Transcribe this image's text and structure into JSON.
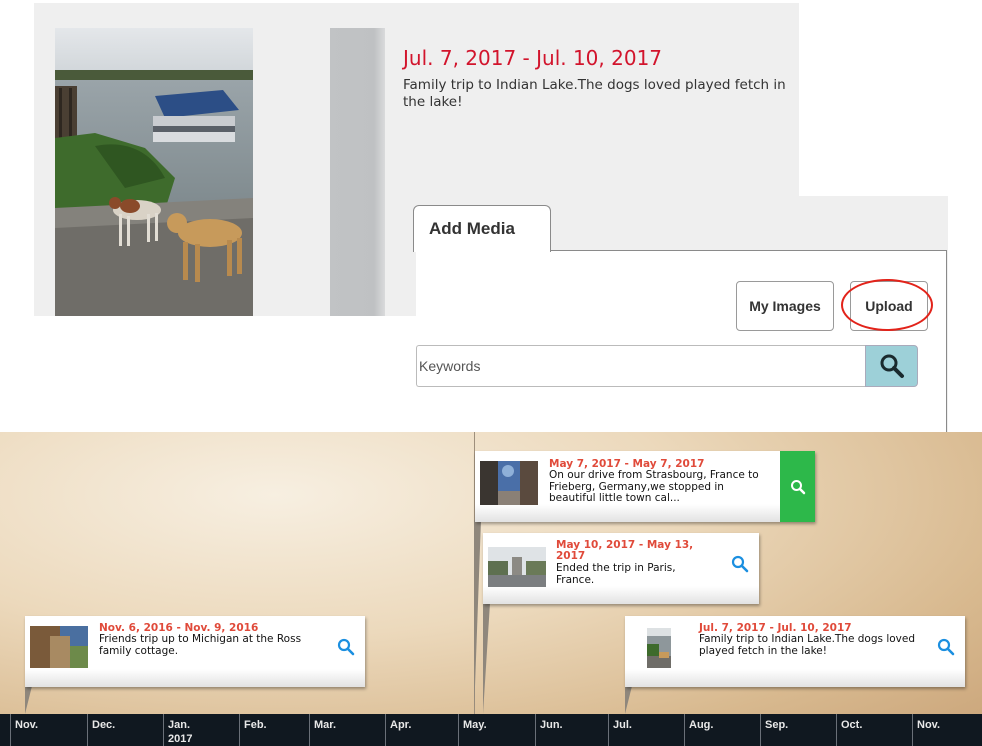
{
  "detail": {
    "date": "Jul. 7, 2017 - Jul. 10, 2017",
    "description": "Family trip to Indian Lake.The dogs loved played fetch in the lake!"
  },
  "media_panel": {
    "tab_label": "Add Media",
    "my_images_label": "My Images",
    "upload_label": "Upload",
    "keywords_placeholder": "Keywords",
    "search_button_color": "#9dd0d8",
    "highlight_color": "#e2231a"
  },
  "timeline": {
    "events": [
      {
        "date": "May 7, 2017 - May 7, 2017",
        "description": "On our drive from Strasbourg, France to Frieberg, Germany,we stopped in beautiful little town cal...",
        "active": true
      },
      {
        "date": "May 10, 2017 - May 13, 2017",
        "description": "Ended the trip in Paris, France."
      },
      {
        "date": "Nov. 6, 2016 - Nov. 9, 2016",
        "description": "Friends trip up to Michigan at the Ross family cottage."
      },
      {
        "date": "Jul. 7, 2017 - Jul. 10, 2017",
        "description": "Family trip to Indian Lake.The dogs loved played fetch in the lake!"
      }
    ],
    "months": [
      "Nov.",
      "Dec.",
      "Jan.",
      "Feb.",
      "Mar.",
      "Apr.",
      "May.",
      "Jun.",
      "Jul.",
      "Aug.",
      "Sep.",
      "Oct.",
      "Nov."
    ],
    "year_label": "2017",
    "active_color": "#2db84a",
    "date_color": "#e04a3a"
  }
}
